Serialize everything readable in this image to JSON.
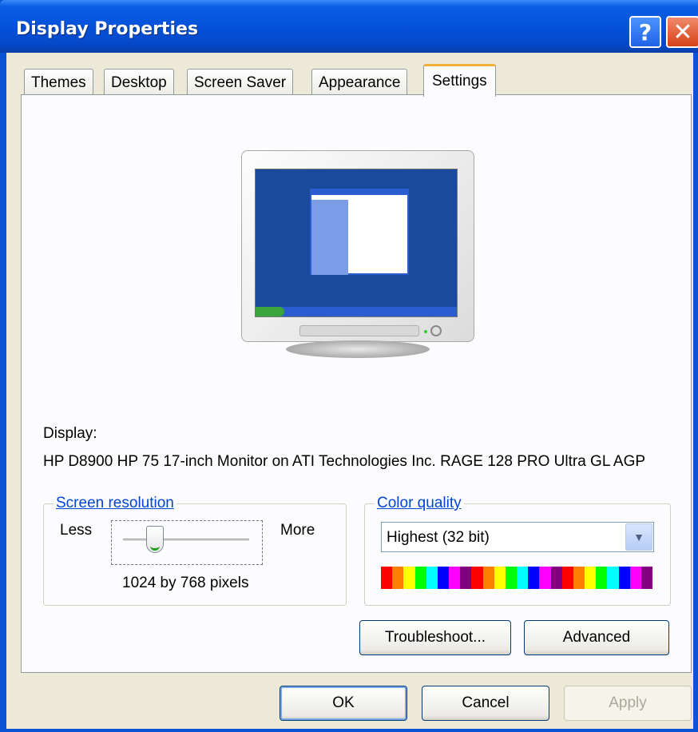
{
  "window": {
    "title": "Display Properties",
    "help_glyph": "?",
    "close_glyph": "✕"
  },
  "tabs": [
    {
      "label": "Themes"
    },
    {
      "label": "Desktop"
    },
    {
      "label": "Screen Saver"
    },
    {
      "label": "Appearance"
    },
    {
      "label": "Settings",
      "selected": true
    }
  ],
  "display": {
    "label": "Display:",
    "description": "HP D8900 HP 75 17-inch Monitor on ATI Technologies Inc. RAGE 128 PRO Ultra GL AGP"
  },
  "screen_resolution": {
    "legend": "Screen resolution",
    "less_label": "Less",
    "more_label": "More",
    "value_text": "1024 by 768 pixels",
    "slider_position_fraction": 0.25
  },
  "color_quality": {
    "legend": "Color quality",
    "selected": "Highest (32 bit)",
    "spectrum_colors": [
      "#ff0000",
      "#ff8000",
      "#ffff00",
      "#00ff00",
      "#00ffff",
      "#0000ff",
      "#ff00ff",
      "#800080",
      "#ff0000",
      "#ff8000",
      "#ffff00",
      "#00ff00",
      "#00ffff",
      "#0000ff",
      "#ff00ff",
      "#800080",
      "#ff0000",
      "#ff8000",
      "#ffff00",
      "#00ff00",
      "#00ffff",
      "#0000ff",
      "#ff00ff",
      "#800080"
    ]
  },
  "buttons": {
    "troubleshoot": "Troubleshoot...",
    "advanced": "Advanced",
    "ok": "OK",
    "cancel": "Cancel",
    "apply": "Apply"
  },
  "colors": {
    "titlebar": "#0653db",
    "accent_link": "#0046d5",
    "selected_tab_highlight": "#f5b03c"
  }
}
